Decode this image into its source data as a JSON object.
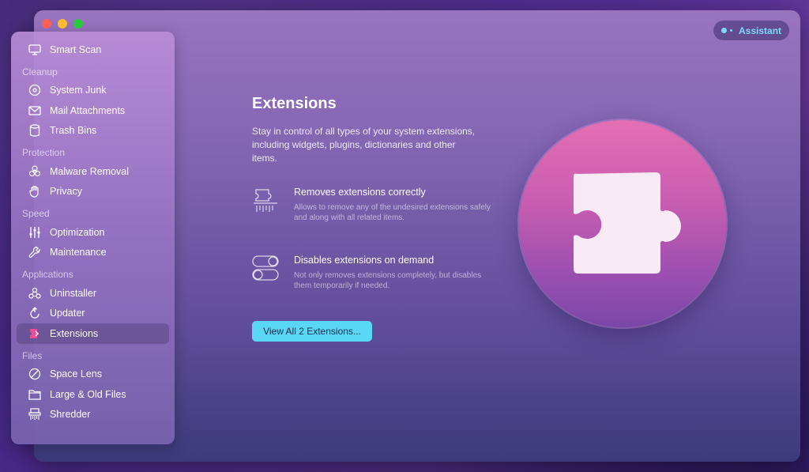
{
  "window": {
    "assistant_label": "Assistant"
  },
  "sidebar": {
    "top_item": {
      "label": "Smart Scan",
      "icon": "monitor-icon"
    },
    "sections": [
      {
        "header": "Cleanup",
        "items": [
          {
            "label": "System Junk",
            "icon": "disk-icon"
          },
          {
            "label": "Mail Attachments",
            "icon": "mail-icon"
          },
          {
            "label": "Trash Bins",
            "icon": "trash-icon"
          }
        ]
      },
      {
        "header": "Protection",
        "items": [
          {
            "label": "Malware Removal",
            "icon": "biohazard-icon"
          },
          {
            "label": "Privacy",
            "icon": "hand-icon"
          }
        ]
      },
      {
        "header": "Speed",
        "items": [
          {
            "label": "Optimization",
            "icon": "sliders-icon"
          },
          {
            "label": "Maintenance",
            "icon": "wrench-icon"
          }
        ]
      },
      {
        "header": "Applications",
        "items": [
          {
            "label": "Uninstaller",
            "icon": "uninstaller-icon"
          },
          {
            "label": "Updater",
            "icon": "updater-icon"
          },
          {
            "label": "Extensions",
            "icon": "extensions-icon",
            "active": true
          }
        ]
      },
      {
        "header": "Files",
        "items": [
          {
            "label": "Space Lens",
            "icon": "lens-icon"
          },
          {
            "label": "Large & Old Files",
            "icon": "folder-icon"
          },
          {
            "label": "Shredder",
            "icon": "shredder-icon"
          }
        ]
      }
    ]
  },
  "main": {
    "title": "Extensions",
    "description": "Stay in control of all types of your system extensions, including widgets, plugins, dictionaries and other items.",
    "features": [
      {
        "title": "Removes extensions correctly",
        "description": "Allows to remove any of the undesired extensions safely and along with all related items.",
        "icon": "shred-puzzle-icon"
      },
      {
        "title": "Disables extensions on demand",
        "description": "Not only removes extensions completely, but disables them temporarily if needed.",
        "icon": "toggle-icon"
      }
    ],
    "button_label": "View All 2 Extensions...",
    "hero_icon": "puzzle-piece-icon"
  },
  "colors": {
    "accent": "#5ad7f5",
    "assistant": "#7fd8ff",
    "hero_top": "#e46fb4",
    "hero_bottom": "#7a47a8"
  }
}
